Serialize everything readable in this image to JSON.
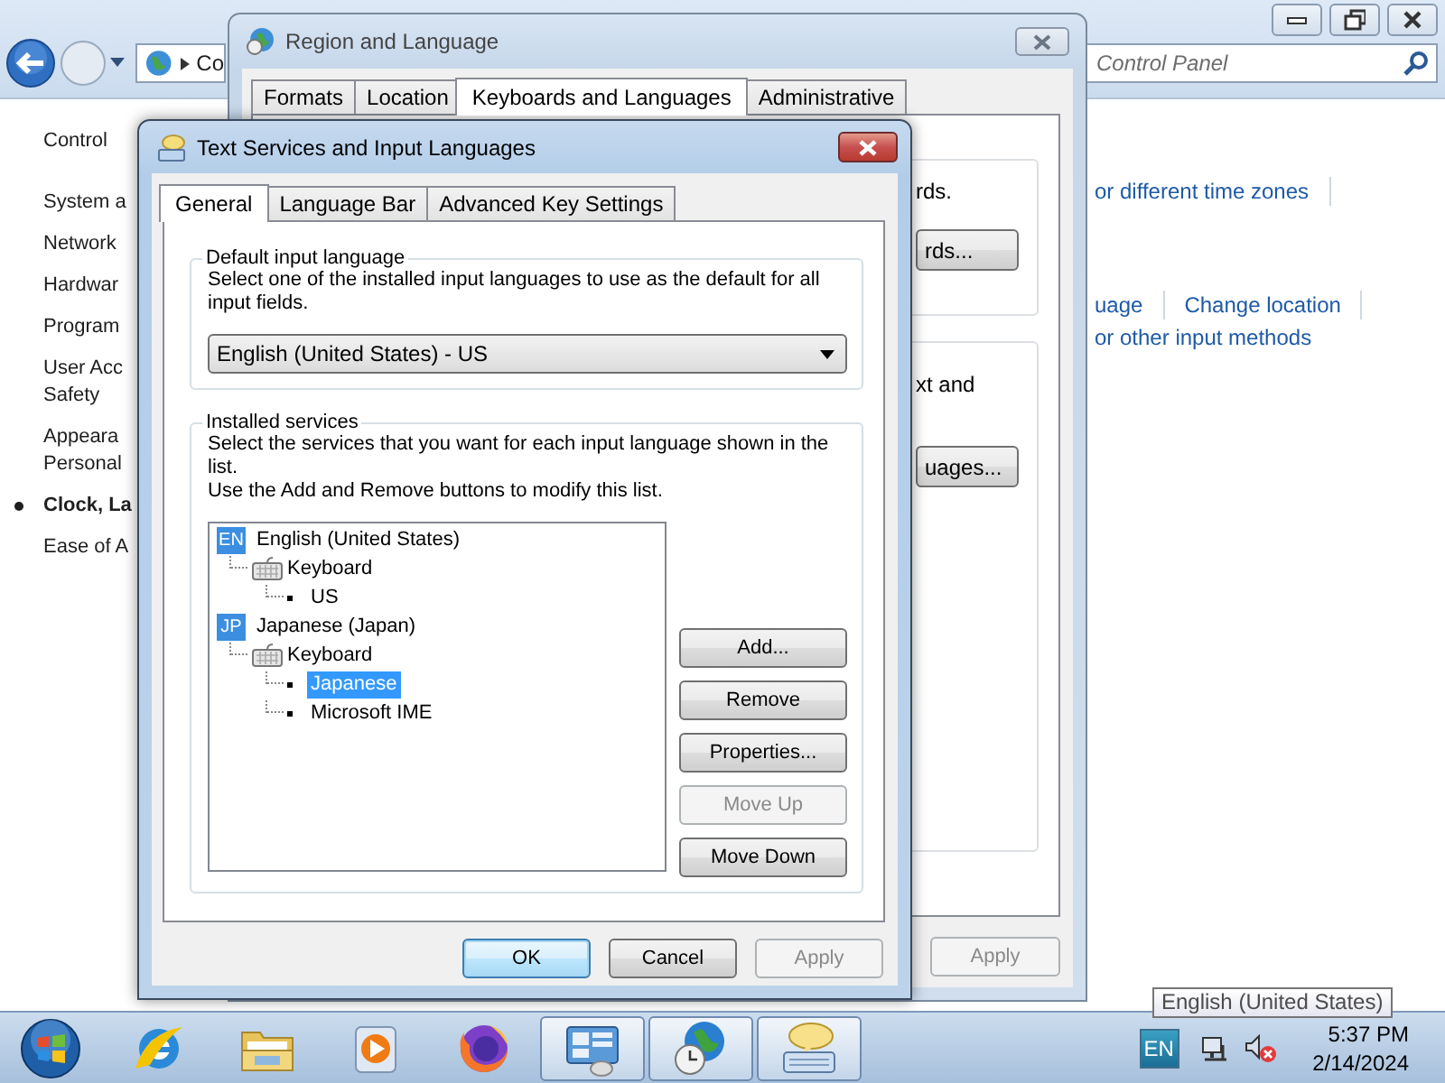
{
  "control_panel": {
    "address_bar": {
      "crumb": "Co"
    },
    "search": {
      "placeholder": "Control Panel"
    },
    "sidebar": {
      "items": [
        {
          "lines": [
            "Control"
          ],
          "kind": "home",
          "selected": false
        },
        {
          "lines": [
            "System a"
          ],
          "kind": "category",
          "selected": false
        },
        {
          "lines": [
            "Network"
          ],
          "kind": "category",
          "selected": false
        },
        {
          "lines": [
            "Hardwar"
          ],
          "kind": "category",
          "selected": false
        },
        {
          "lines": [
            "Program"
          ],
          "kind": "category",
          "selected": false
        },
        {
          "lines": [
            "User Acc",
            "Safety"
          ],
          "kind": "category",
          "selected": false
        },
        {
          "lines": [
            "Appeara",
            "Personal"
          ],
          "kind": "category",
          "selected": false
        },
        {
          "lines": [
            "Clock, La"
          ],
          "kind": "category",
          "selected": true
        },
        {
          "lines": [
            "Ease of A"
          ],
          "kind": "category",
          "selected": false
        }
      ]
    },
    "link_rows": [
      [
        "or different time zones"
      ],
      [
        "uage",
        "Change location"
      ],
      [
        "or other input methods"
      ]
    ]
  },
  "region_dialog": {
    "title": "Region and Language",
    "tabs": [
      {
        "label": "Formats",
        "selected": false
      },
      {
        "label": "Location",
        "selected": false
      },
      {
        "label": "Keyboards and Languages",
        "selected": true
      },
      {
        "label": "Administrative",
        "selected": false
      }
    ],
    "groups": [
      {
        "text": "rds.",
        "button": "rds..."
      },
      {
        "text": "xt and",
        "button": "uages..."
      }
    ],
    "buttons": [
      {
        "label": "Apply",
        "disabled": true
      }
    ]
  },
  "text_services_dialog": {
    "title": "Text Services and Input Languages",
    "tabs": [
      {
        "label": "General",
        "selected": true
      },
      {
        "label": "Language Bar",
        "selected": false
      },
      {
        "label": "Advanced Key Settings",
        "selected": false
      }
    ],
    "default_input_language": {
      "legend": "Default input language",
      "description": "Select one of the installed input languages to use as the default for all input fields.",
      "value": "English (United States) - US"
    },
    "installed_services": {
      "legend": "Installed services",
      "description": "Select the services that you want for each input language shown in the list.\nUse the Add and Remove buttons to modify this list.",
      "tree": [
        {
          "badge": "EN",
          "label": "English (United States)",
          "selected": false,
          "children": [
            {
              "label": "Keyboard",
              "selected": false,
              "children": [
                {
                  "label": "US",
                  "selected": false
                }
              ]
            }
          ]
        },
        {
          "badge": "JP",
          "label": "Japanese (Japan)",
          "selected": false,
          "children": [
            {
              "label": "Keyboard",
              "selected": false,
              "children": [
                {
                  "label": "Japanese",
                  "selected": true
                },
                {
                  "label": "Microsoft IME",
                  "selected": false
                }
              ]
            }
          ]
        }
      ],
      "buttons": [
        {
          "label": "Add...",
          "disabled": false
        },
        {
          "label": "Remove",
          "disabled": false
        },
        {
          "label": "Properties...",
          "disabled": false
        },
        {
          "label": "Move Up",
          "disabled": true
        },
        {
          "label": "Move Down",
          "disabled": false
        }
      ]
    },
    "buttons": [
      {
        "label": "OK",
        "default": true,
        "disabled": false
      },
      {
        "label": "Cancel",
        "default": false,
        "disabled": false
      },
      {
        "label": "Apply",
        "default": false,
        "disabled": true
      }
    ]
  },
  "taskbar": {
    "apps": [
      {
        "kind": "start",
        "active": false
      },
      {
        "kind": "ie",
        "active": false
      },
      {
        "kind": "folder",
        "active": false
      },
      {
        "kind": "media",
        "active": false
      },
      {
        "kind": "firefox",
        "active": false
      },
      {
        "kind": "control-panel",
        "active": true
      },
      {
        "kind": "globe-clock",
        "active": true
      },
      {
        "kind": "keyboard-bubble",
        "active": true
      }
    ],
    "tray": {
      "language": "EN",
      "time": "5:37 PM",
      "date": "2/14/2024"
    },
    "tooltip": "English (United States)"
  }
}
